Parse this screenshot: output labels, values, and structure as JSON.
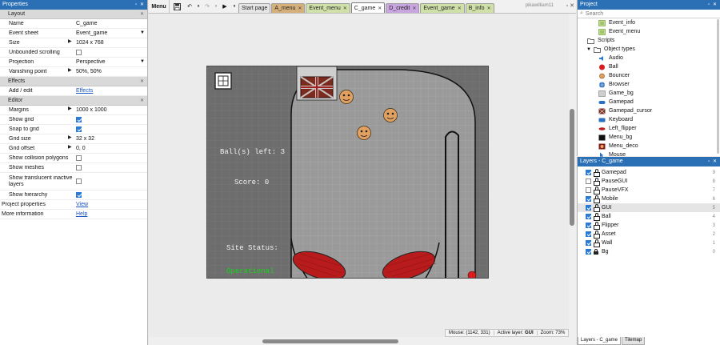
{
  "properties": {
    "title": "Properties",
    "sections": [
      {
        "label": "Layout",
        "rows": [
          {
            "key": "Name",
            "value": "C_game"
          },
          {
            "key": "Event sheet",
            "value": "Event_game",
            "select": true
          },
          {
            "key": "Size",
            "value": "1024 x 768",
            "expand": true
          },
          {
            "key": "Unbounded scrolling",
            "check": false
          },
          {
            "key": "Projection",
            "value": "Perspective",
            "select": true
          },
          {
            "key": "Vanishing point",
            "value": "50%, 50%",
            "expand": true
          }
        ]
      },
      {
        "label": "Effects",
        "rows": [
          {
            "key": "Add / edit",
            "link": "Effects"
          }
        ]
      },
      {
        "label": "Editor",
        "rows": [
          {
            "key": "Margins",
            "value": "1000 x 1000",
            "expand": true
          },
          {
            "key": "Show grid",
            "check": true
          },
          {
            "key": "Snap to grid",
            "check": true
          },
          {
            "key": "Grid size",
            "value": "32 x 32",
            "expand": true
          },
          {
            "key": "Grid offset",
            "value": "0, 0",
            "expand": true
          },
          {
            "key": "Show collision polygons",
            "check": false
          },
          {
            "key": "Show meshes",
            "check": false
          },
          {
            "key": "Show translucent inactive layers",
            "check": false,
            "tall": true
          },
          {
            "key": "Show hierarchy",
            "check": true
          }
        ]
      }
    ],
    "footer": [
      {
        "key": "Project properties",
        "link": "View"
      },
      {
        "key": "More information",
        "link": "Help"
      }
    ]
  },
  "toolbar": {
    "menu": "Menu",
    "user": "pikawilliam11"
  },
  "tabs": [
    {
      "label": "Start page",
      "color": "#e6e6e6",
      "close": false
    },
    {
      "label": "A_menu",
      "color": "#d6b07a",
      "close": true
    },
    {
      "label": "Event_menu",
      "color": "#cfe0a8",
      "close": true
    },
    {
      "label": "C_game",
      "color": "#ffffff",
      "close": true
    },
    {
      "label": "D_credit",
      "color": "#c9a6e0",
      "close": true
    },
    {
      "label": "Event_game",
      "color": "#cfe0a8",
      "close": true
    },
    {
      "label": "B_info",
      "color": "#cfe0a8",
      "close": true
    }
  ],
  "scene": {
    "balls_text": "Ball(s) left: 3",
    "score_text": "Score: 0",
    "site_status": "Site Status:",
    "operational": "Operational",
    "colors": {
      "bg": "#6d6d6d",
      "floor": "#9a9a9a",
      "flipper": "#b81b1b",
      "face": "#e1a060",
      "op": "#19d419"
    }
  },
  "status": {
    "mouse": "Mouse: (1142, 331)",
    "layer_label": "Active layer:",
    "layer": "GUI",
    "zoom": "Zoom: 73%"
  },
  "project": {
    "title": "Project",
    "search_placeholder": "Search",
    "items": [
      {
        "label": "Event_info",
        "icon": "event-sheet-icon",
        "indent": 2
      },
      {
        "label": "Event_menu",
        "icon": "event-sheet-icon",
        "indent": 2
      },
      {
        "label": "Scripts",
        "icon": "folder-icon",
        "indent": 1
      },
      {
        "label": "Object types",
        "icon": "folder-open-icon",
        "indent": 1,
        "expanded": true
      },
      {
        "label": "Audio",
        "icon": "audio-icon",
        "indent": 2
      },
      {
        "label": "Ball",
        "icon": "ball-icon",
        "indent": 2
      },
      {
        "label": "Bouncer",
        "icon": "bouncer-icon",
        "indent": 2
      },
      {
        "label": "Browser",
        "icon": "browser-icon",
        "indent": 2
      },
      {
        "label": "Game_bg",
        "icon": "image-icon",
        "indent": 2
      },
      {
        "label": "Gamepad",
        "icon": "gamepad-icon",
        "indent": 2
      },
      {
        "label": "Gamepad_cursor",
        "icon": "cursor-sprite-icon",
        "indent": 2
      },
      {
        "label": "Keyboard",
        "icon": "keyboard-icon",
        "indent": 2
      },
      {
        "label": "Left_flipper",
        "icon": "flipper-icon",
        "indent": 2
      },
      {
        "label": "Menu_bg",
        "icon": "menu-bg-icon",
        "indent": 2
      },
      {
        "label": "Menu_deco",
        "icon": "menu-deco-icon",
        "indent": 2
      },
      {
        "label": "Mouse",
        "icon": "mouse-icon",
        "indent": 2
      }
    ]
  },
  "layers": {
    "title": "Layers - C_game",
    "items": [
      {
        "label": "Gamepad",
        "visible": true,
        "locked": false,
        "num": "9"
      },
      {
        "label": "PauseGUI",
        "visible": false,
        "locked": false,
        "num": "8"
      },
      {
        "label": "PauseVFX",
        "visible": false,
        "locked": false,
        "num": "7"
      },
      {
        "label": "Mobile",
        "visible": true,
        "locked": false,
        "num": "6"
      },
      {
        "label": "GUI",
        "visible": true,
        "locked": false,
        "num": "5",
        "selected": true
      },
      {
        "label": "Ball",
        "visible": true,
        "locked": false,
        "num": "4"
      },
      {
        "label": "Flipper",
        "visible": true,
        "locked": false,
        "num": "3"
      },
      {
        "label": "Asset",
        "visible": true,
        "locked": false,
        "num": "2"
      },
      {
        "label": "Wall",
        "visible": true,
        "locked": false,
        "num": "1"
      },
      {
        "label": "Bg",
        "visible": true,
        "locked": true,
        "num": "0"
      }
    ]
  },
  "bottom_tabs": [
    "Layers - C_game",
    "Tilemap"
  ]
}
